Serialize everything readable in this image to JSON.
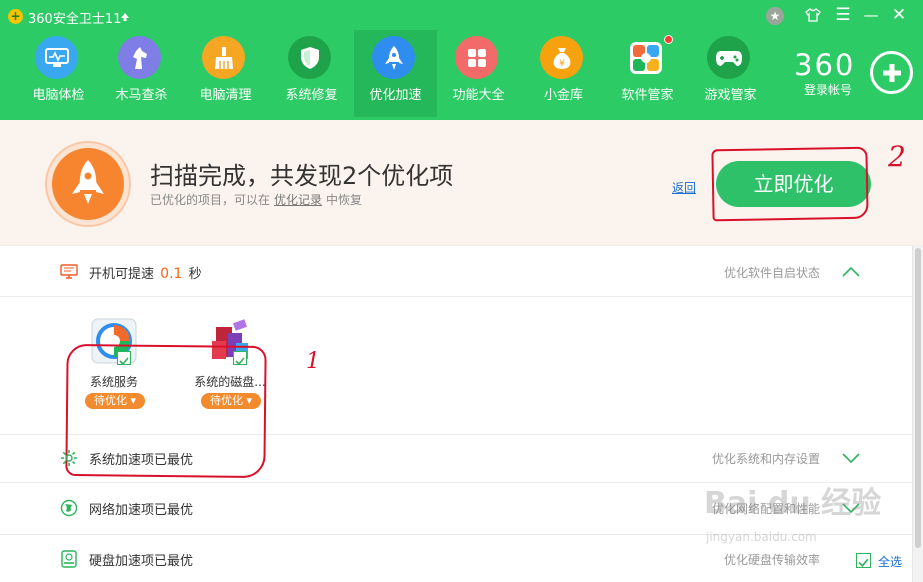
{
  "app": {
    "title": "360安全卫士11",
    "logo_glyph": "+"
  },
  "window_controls": {
    "medal_icon": "medal-icon",
    "skin_icon": "shirt-icon",
    "menu_icon": "menu-icon",
    "minimize_icon": "minimize-icon",
    "close_icon": "close-icon",
    "close_glyph": "✕",
    "menu_glyph": "☰",
    "minimize_glyph": "—"
  },
  "nav": {
    "items": [
      {
        "label": "电脑体检",
        "icon": "monitor-checkup-icon",
        "color": "#3aa8f0"
      },
      {
        "label": "木马查杀",
        "icon": "horse-icon",
        "color": "#7f7ee6"
      },
      {
        "label": "电脑清理",
        "icon": "broom-icon",
        "color": "#f5a623"
      },
      {
        "label": "系统修复",
        "icon": "shield-icon",
        "color": "#1fa34a"
      },
      {
        "label": "优化加速",
        "icon": "rocket-icon",
        "color": "#2f8df0",
        "active": true
      },
      {
        "label": "功能大全",
        "icon": "grid-icon",
        "color": "#f26a6a"
      },
      {
        "label": "小金库",
        "icon": "money-bag-icon",
        "color": "#f5a20e"
      },
      {
        "label": "软件管家",
        "icon": "software-manager-icon",
        "color": "#f16e3b",
        "badge": true
      },
      {
        "label": "游戏管家",
        "icon": "gamepad-icon",
        "color": "#1fa34a"
      }
    ]
  },
  "account": {
    "brand": "360",
    "login_label": "登录帐号"
  },
  "summary": {
    "title": "扫描完成，共发现2个优化项",
    "sub_prefix": "已优化的项目，可以在",
    "sub_link": "优化记录",
    "sub_suffix": "中恢复",
    "back_link": "返回",
    "optimize_button": "立即优化"
  },
  "annotations": {
    "one": "1",
    "two": "2"
  },
  "sections": {
    "startup": {
      "title_prefix": "开机可提速",
      "value": "0.1",
      "unit": "秒",
      "desc": "优化软件自启状态",
      "expanded": true
    },
    "items": [
      {
        "name": "系统服务",
        "status": "待优化 ▾",
        "checked": true
      },
      {
        "name": "系统的磁盘...",
        "status": "待优化 ▾",
        "checked": true
      }
    ],
    "system": {
      "title": "系统加速项已最优",
      "desc": "优化系统和内存设置"
    },
    "network": {
      "title": "网络加速项已最优",
      "desc": "优化网络配置和性能"
    },
    "disk": {
      "title": "硬盘加速项已最优",
      "desc": "优化硬盘传输效率"
    }
  },
  "footer": {
    "select_all": "全选"
  },
  "watermark": {
    "logo": "Bai du 经验",
    "sub": "jingyan.baidu.com"
  }
}
